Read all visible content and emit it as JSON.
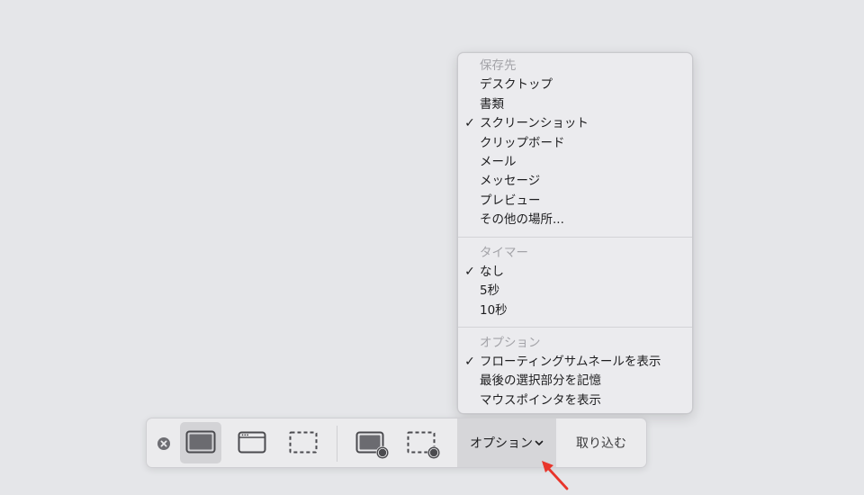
{
  "options_menu": {
    "sections": [
      {
        "header": "保存先",
        "items": [
          {
            "label": "デスクトップ",
            "checked": false
          },
          {
            "label": "書類",
            "checked": false
          },
          {
            "label": "スクリーンショット",
            "checked": true
          },
          {
            "label": "クリップボード",
            "checked": false
          },
          {
            "label": "メール",
            "checked": false
          },
          {
            "label": "メッセージ",
            "checked": false
          },
          {
            "label": "プレビュー",
            "checked": false
          },
          {
            "label": "その他の場所...",
            "checked": false
          }
        ]
      },
      {
        "header": "タイマー",
        "items": [
          {
            "label": "なし",
            "checked": true
          },
          {
            "label": "5秒",
            "checked": false
          },
          {
            "label": "10秒",
            "checked": false
          }
        ]
      },
      {
        "header": "オプション",
        "items": [
          {
            "label": "フローティングサムネールを表示",
            "checked": true
          },
          {
            "label": "最後の選択部分を記憶",
            "checked": false
          },
          {
            "label": "マウスポインタを表示",
            "checked": false
          }
        ]
      }
    ],
    "check_glyph": "✓"
  },
  "toolbar": {
    "close_icon": "close-circle-icon",
    "capture_modes": [
      {
        "icon": "capture-entire-screen-icon",
        "selected": true
      },
      {
        "icon": "capture-window-icon",
        "selected": false
      },
      {
        "icon": "capture-selection-icon",
        "selected": false
      }
    ],
    "record_modes": [
      {
        "icon": "record-entire-screen-icon",
        "selected": false
      },
      {
        "icon": "record-selection-icon",
        "selected": false
      }
    ],
    "options_label": "オプション",
    "options_chevron_icon": "chevron-down-icon",
    "capture_label": "取り込む"
  },
  "annotation": {
    "arrow_icon": "red-arrow-icon",
    "arrow_color": "#e8352b"
  },
  "colors": {
    "background": "#e5e6e9",
    "menu_background": "#ebebee",
    "header_text": "#a3a3a8",
    "selected_button": "#d3d3d6"
  }
}
